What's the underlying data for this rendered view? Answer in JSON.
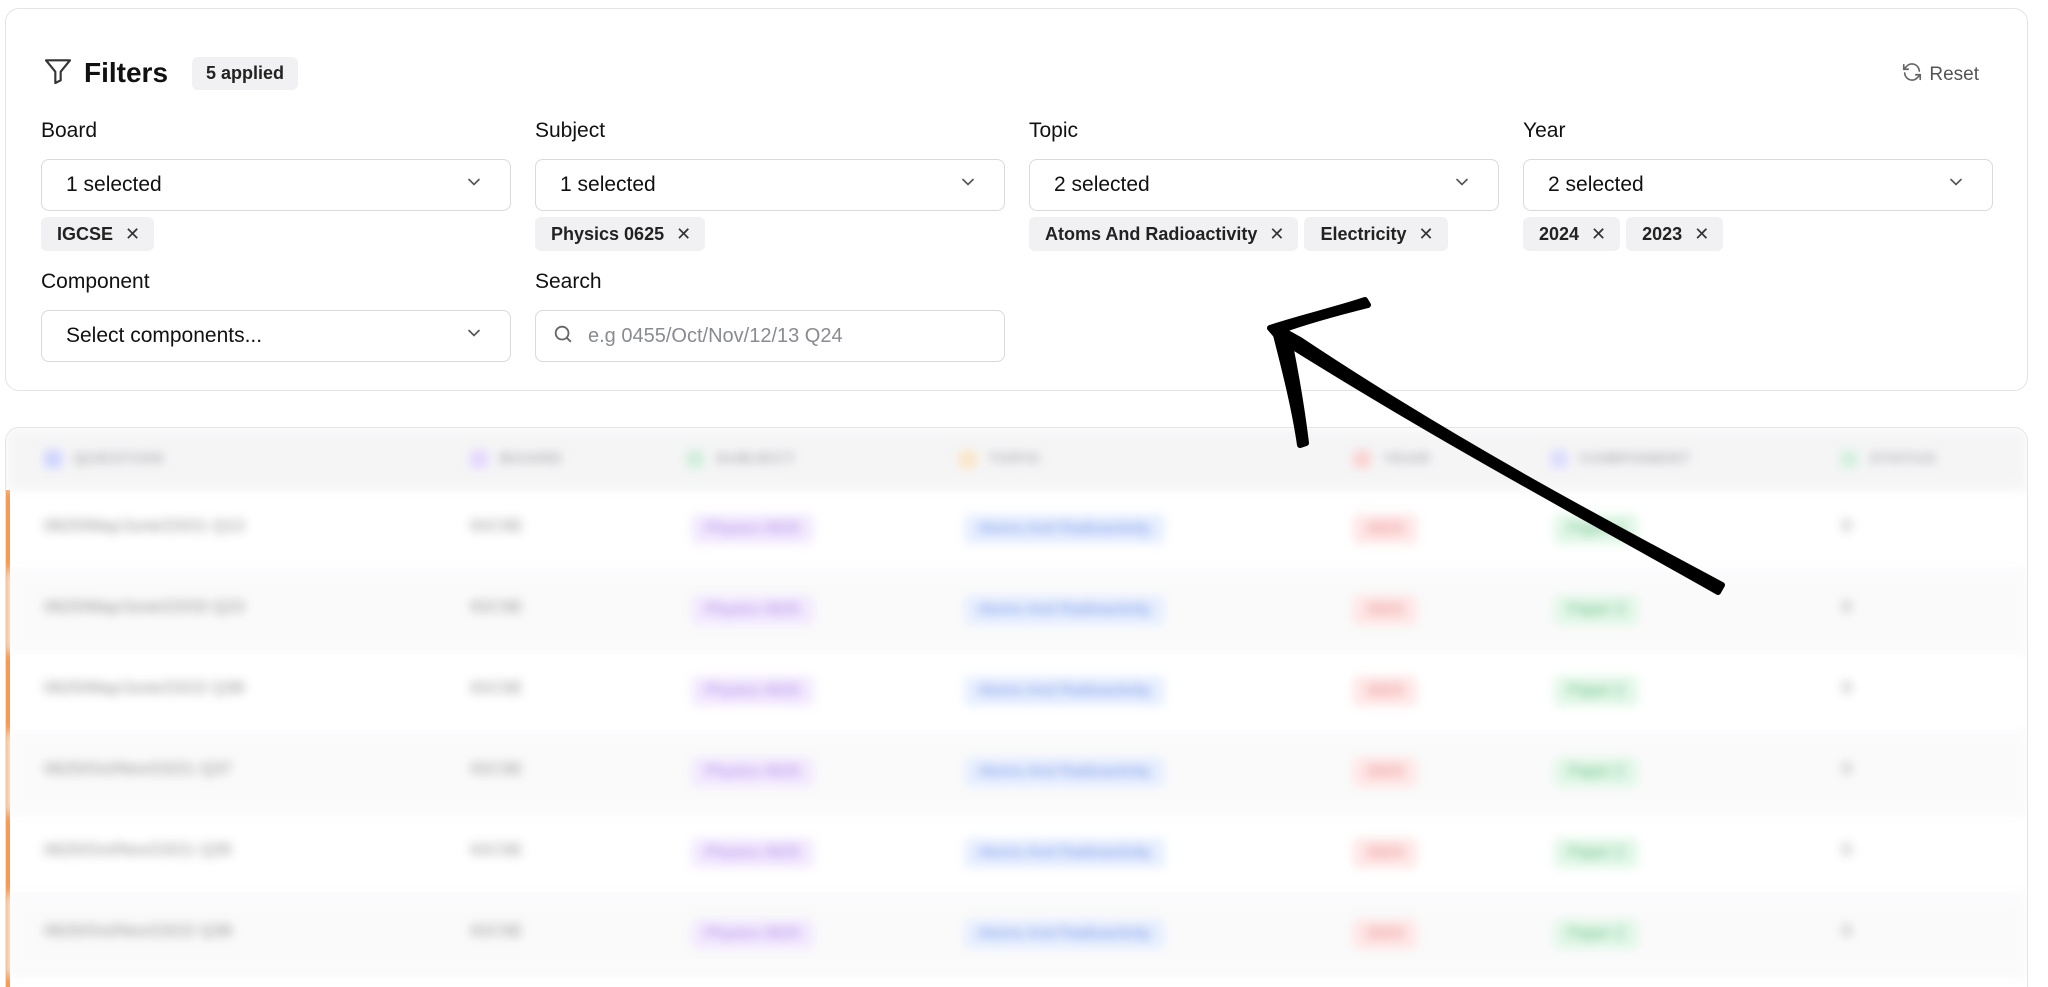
{
  "filters": {
    "title": "Filters",
    "applied_badge": "5 applied",
    "reset_label": "Reset"
  },
  "fields": {
    "board": {
      "label": "Board",
      "value": "1 selected",
      "chips": [
        "IGCSE"
      ]
    },
    "subject": {
      "label": "Subject",
      "value": "1 selected",
      "chips": [
        "Physics 0625"
      ]
    },
    "topic": {
      "label": "Topic",
      "value": "2 selected",
      "chips": [
        "Atoms And Radioactivity",
        "Electricity"
      ]
    },
    "year": {
      "label": "Year",
      "value": "2 selected",
      "chips": [
        "2024",
        "2023"
      ]
    },
    "component": {
      "label": "Component",
      "value": "Select components..."
    },
    "search": {
      "label": "Search",
      "placeholder": "e.g 0455/Oct/Nov/12/13 Q24"
    }
  },
  "chip_remove_glyph": "✕",
  "table": {
    "headers": [
      "QUESTION",
      "BOARD",
      "SUBJECT",
      "TOPIC",
      "YEAR",
      "COMPONENT",
      "STATUS"
    ],
    "header_colors": [
      "#6b7cff",
      "#b18cff",
      "#5ec48a",
      "#f2b45c",
      "#f07a7a",
      "#8b8cff",
      "#7fcf9a"
    ],
    "rows": [
      [
        "0625/May/June/23/21 Q13",
        "IGCSE",
        "Physics 0625",
        "Atoms And Radioactivity",
        "2023",
        "Paper 2",
        "0"
      ],
      [
        "0625/May/June/23/33 Q23",
        "IGCSE",
        "Physics 0625",
        "Atoms And Radioactivity",
        "2023",
        "Paper 3",
        "0"
      ],
      [
        "0625/May/June/23/22 Q38",
        "IGCSE",
        "Physics 0625",
        "Atoms And Radioactivity",
        "2023",
        "Paper 2",
        "0"
      ],
      [
        "0625/Oct/Nov/23/21 Q37",
        "IGCSE",
        "Physics 0625",
        "Atoms And Radioactivity",
        "2023",
        "Paper 2",
        "0"
      ],
      [
        "0625/Oct/Nov/23/21 Q35",
        "IGCSE",
        "Physics 0625",
        "Atoms And Radioactivity",
        "2023",
        "Paper 2",
        "0"
      ],
      [
        "0625/Oct/Nov/23/22 Q38",
        "IGCSE",
        "Physics 0625",
        "Atoms And Radioactivity",
        "2023",
        "Paper 2",
        "0"
      ]
    ]
  },
  "colors": {
    "subject_pill_bg": "#f1e6ff",
    "subject_pill_fg": "#9b6bdc",
    "topic_pill_bg": "#e3ecff",
    "topic_pill_fg": "#5b7fe0",
    "year_pill_bg": "#ffe2e2",
    "year_pill_fg": "#e06b6b",
    "component_pill_bg": "#ddf6e4",
    "component_pill_fg": "#4fb36f"
  }
}
